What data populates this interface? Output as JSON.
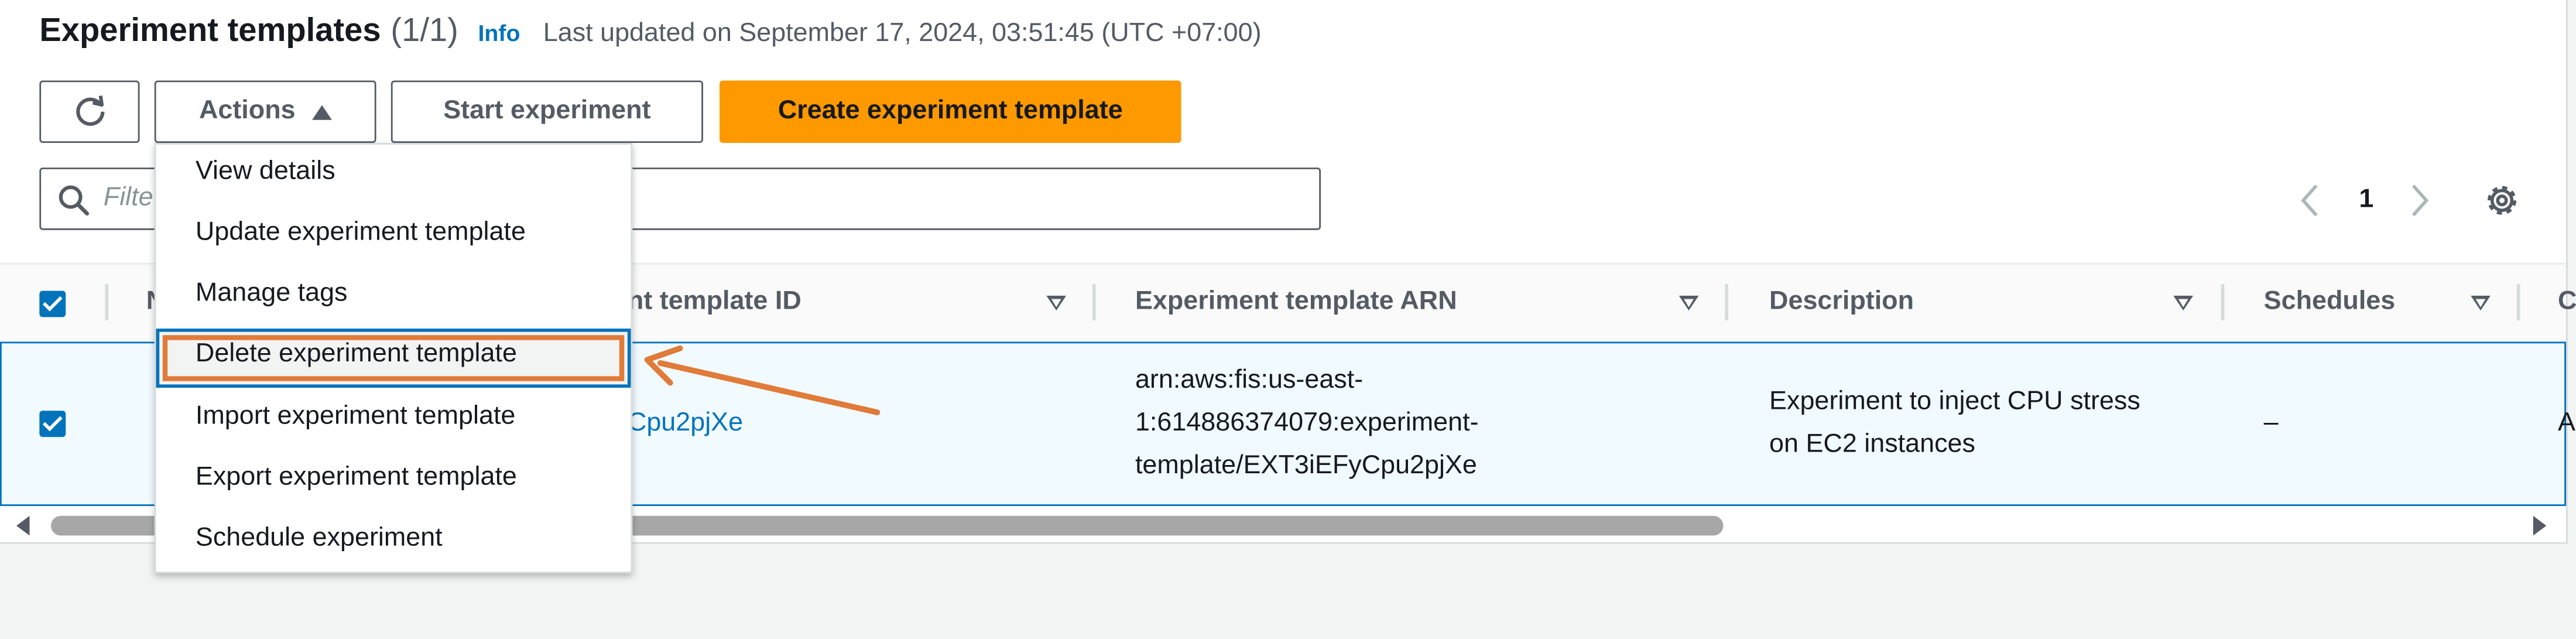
{
  "header": {
    "title": "Experiment templates",
    "count": "(1/1)",
    "info": "Info",
    "updated": "Last updated on September 17, 2024, 03:51:45 (UTC +07:00)"
  },
  "toolbar": {
    "actions_label": "Actions",
    "start_label": "Start experiment",
    "create_label": "Create experiment template"
  },
  "filter": {
    "placeholder_visible": "Filte"
  },
  "pagination": {
    "current_page": "1"
  },
  "table": {
    "columns": [
      {
        "label": "N"
      },
      {
        "label": "nt template ID"
      },
      {
        "label": "Experiment template ARN"
      },
      {
        "label": "Description"
      },
      {
        "label": "Schedules"
      },
      {
        "label": "C"
      }
    ],
    "rows": [
      {
        "id": "Cpu2pjXe",
        "arn_line1": "arn:aws:fis:us-east-",
        "arn_line2": "1:614886374079:experiment-",
        "arn_line3": "template/EXT3iEFyCpu2pjXe",
        "description_line1": "Experiment to inject CPU stress",
        "description_line2": "on EC2 instances",
        "schedules": "–",
        "overflow": "A"
      }
    ]
  },
  "actions_menu": {
    "items": [
      "View details",
      "Update experiment template",
      "Manage tags",
      "Delete experiment template",
      "Import experiment template",
      "Export experiment template",
      "Schedule experiment"
    ],
    "highlighted_index": 3
  },
  "colors": {
    "accent": "#0073bb",
    "primary_button": "#ff9900",
    "annotation": "#e07b39"
  }
}
